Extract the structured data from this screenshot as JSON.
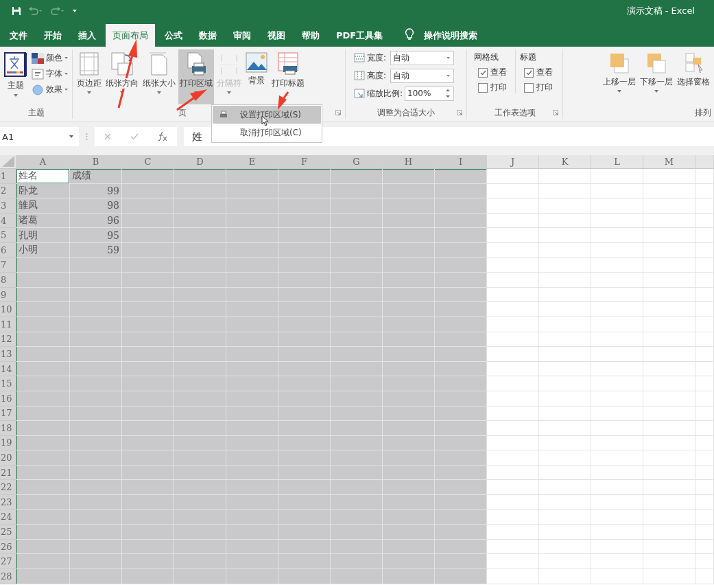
{
  "title_bar": {
    "title": "演示文稿  -  Excel"
  },
  "ribbon_tabs": [
    {
      "label": "文件",
      "selected": false
    },
    {
      "label": "开始",
      "selected": false
    },
    {
      "label": "插入",
      "selected": false
    },
    {
      "label": "页面布局",
      "selected": true
    },
    {
      "label": "公式",
      "selected": false
    },
    {
      "label": "数据",
      "selected": false
    },
    {
      "label": "审阅",
      "selected": false
    },
    {
      "label": "视图",
      "selected": false
    },
    {
      "label": "帮助",
      "selected": false
    },
    {
      "label": "PDF工具集",
      "selected": false
    }
  ],
  "tell_me": {
    "label": "操作说明搜索"
  },
  "ribbon_groups": [
    {
      "kind": "themes",
      "label": "主题",
      "launcher": false,
      "theme_button": {
        "label": "主题",
        "menu": true
      },
      "options": [
        {
          "label": "颜色"
        },
        {
          "label": "字体"
        },
        {
          "label": "效果"
        }
      ]
    },
    {
      "kind": "buttons",
      "label": "页",
      "launcher": true,
      "buttons": [
        {
          "label": "页边距",
          "menu": true,
          "pressed": false,
          "disabled": false
        },
        {
          "label": "纸张方向",
          "menu": true,
          "pressed": false,
          "disabled": false
        },
        {
          "label": "纸张大小",
          "menu": true,
          "pressed": false,
          "disabled": false
        },
        {
          "label": "打印区域",
          "menu": true,
          "pressed": true,
          "disabled": false
        },
        {
          "label": "分隔符",
          "menu": true,
          "pressed": false,
          "disabled": true
        },
        {
          "label": "背景",
          "menu": false,
          "pressed": false,
          "disabled": false
        },
        {
          "label": "打印标题",
          "menu": false,
          "pressed": false,
          "disabled": false
        }
      ]
    },
    {
      "kind": "scale",
      "label": "调整为合适大小",
      "launcher": true,
      "fields": [
        {
          "kind": "dropdown",
          "label": "宽度:",
          "value": "自动"
        },
        {
          "kind": "dropdown",
          "label": "高度:",
          "value": "自动"
        },
        {
          "kind": "spinner",
          "label": "缩放比例:",
          "value": "100%"
        }
      ]
    },
    {
      "kind": "sheet_options",
      "label": "工作表选项",
      "launcher": true,
      "columns": [
        {
          "heading": "网格线",
          "options": [
            {
              "label": "查看",
              "checked": true
            },
            {
              "label": "打印",
              "checked": false
            }
          ]
        },
        {
          "heading": "标题",
          "options": [
            {
              "label": "查看",
              "checked": true
            },
            {
              "label": "打印",
              "checked": false
            }
          ]
        }
      ]
    },
    {
      "kind": "buttons",
      "label": "排列",
      "launcher": false,
      "buttons": [
        {
          "label": "上移一层",
          "menu": true,
          "pressed": false,
          "disabled": false
        },
        {
          "label": "下移一层",
          "menu": true,
          "pressed": false,
          "disabled": false
        },
        {
          "label": "选择窗格",
          "menu": false,
          "pressed": false,
          "disabled": false
        }
      ]
    }
  ],
  "print_area_menu": {
    "items": [
      {
        "label": "设置打印区域(S)",
        "selected": true
      },
      {
        "label": "取消打印区域(C)",
        "selected": false
      }
    ]
  },
  "formula_bar": {
    "name_box": "A1",
    "formula": "姓"
  },
  "grid": {
    "columns": [
      {
        "label": "A",
        "selected": true
      },
      {
        "label": "B",
        "selected": true
      },
      {
        "label": "C",
        "selected": true
      },
      {
        "label": "D",
        "selected": true
      },
      {
        "label": "E",
        "selected": true
      },
      {
        "label": "F",
        "selected": true
      },
      {
        "label": "G",
        "selected": true
      },
      {
        "label": "H",
        "selected": true
      },
      {
        "label": "I",
        "selected": true
      },
      {
        "label": "J",
        "selected": false
      },
      {
        "label": "K",
        "selected": false
      },
      {
        "label": "L",
        "selected": false
      },
      {
        "label": "M",
        "selected": false
      }
    ],
    "rows": [
      {
        "label": "1",
        "selected": true,
        "cells": [
          {
            "text": "姓名",
            "kind": "text",
            "active": true
          },
          {
            "text": "成绩",
            "kind": "text",
            "active": false
          }
        ]
      },
      {
        "label": "2",
        "selected": true,
        "cells": [
          {
            "text": "卧龙",
            "kind": "text",
            "active": false
          },
          {
            "text": "99",
            "kind": "number",
            "active": false
          }
        ]
      },
      {
        "label": "3",
        "selected": true,
        "cells": [
          {
            "text": "雏凤",
            "kind": "text",
            "active": false
          },
          {
            "text": "98",
            "kind": "number",
            "active": false
          }
        ]
      },
      {
        "label": "4",
        "selected": true,
        "cells": [
          {
            "text": "诸葛",
            "kind": "text",
            "active": false
          },
          {
            "text": "96",
            "kind": "number",
            "active": false
          }
        ]
      },
      {
        "label": "5",
        "selected": true,
        "cells": [
          {
            "text": "孔明",
            "kind": "text",
            "active": false
          },
          {
            "text": "95",
            "kind": "number",
            "active": false
          }
        ]
      },
      {
        "label": "6",
        "selected": true,
        "cells": [
          {
            "text": "小明",
            "kind": "text",
            "active": false
          },
          {
            "text": "59",
            "kind": "number",
            "active": false
          }
        ]
      },
      {
        "label": "7",
        "selected": true
      },
      {
        "label": "8",
        "selected": true
      },
      {
        "label": "9",
        "selected": true
      },
      {
        "label": "10",
        "selected": true
      },
      {
        "label": "11",
        "selected": true
      },
      {
        "label": "12",
        "selected": true
      },
      {
        "label": "13",
        "selected": true
      },
      {
        "label": "14",
        "selected": true
      },
      {
        "label": "15",
        "selected": true
      },
      {
        "label": "16",
        "selected": true
      },
      {
        "label": "17",
        "selected": true
      },
      {
        "label": "18",
        "selected": true
      },
      {
        "label": "19",
        "selected": true
      },
      {
        "label": "20",
        "selected": true
      },
      {
        "label": "21",
        "selected": true
      },
      {
        "label": "22",
        "selected": true
      },
      {
        "label": "23",
        "selected": true
      },
      {
        "label": "24",
        "selected": true
      },
      {
        "label": "25",
        "selected": true
      },
      {
        "label": "26",
        "selected": true
      },
      {
        "label": "27",
        "selected": true
      },
      {
        "label": "28",
        "selected": true
      }
    ]
  }
}
